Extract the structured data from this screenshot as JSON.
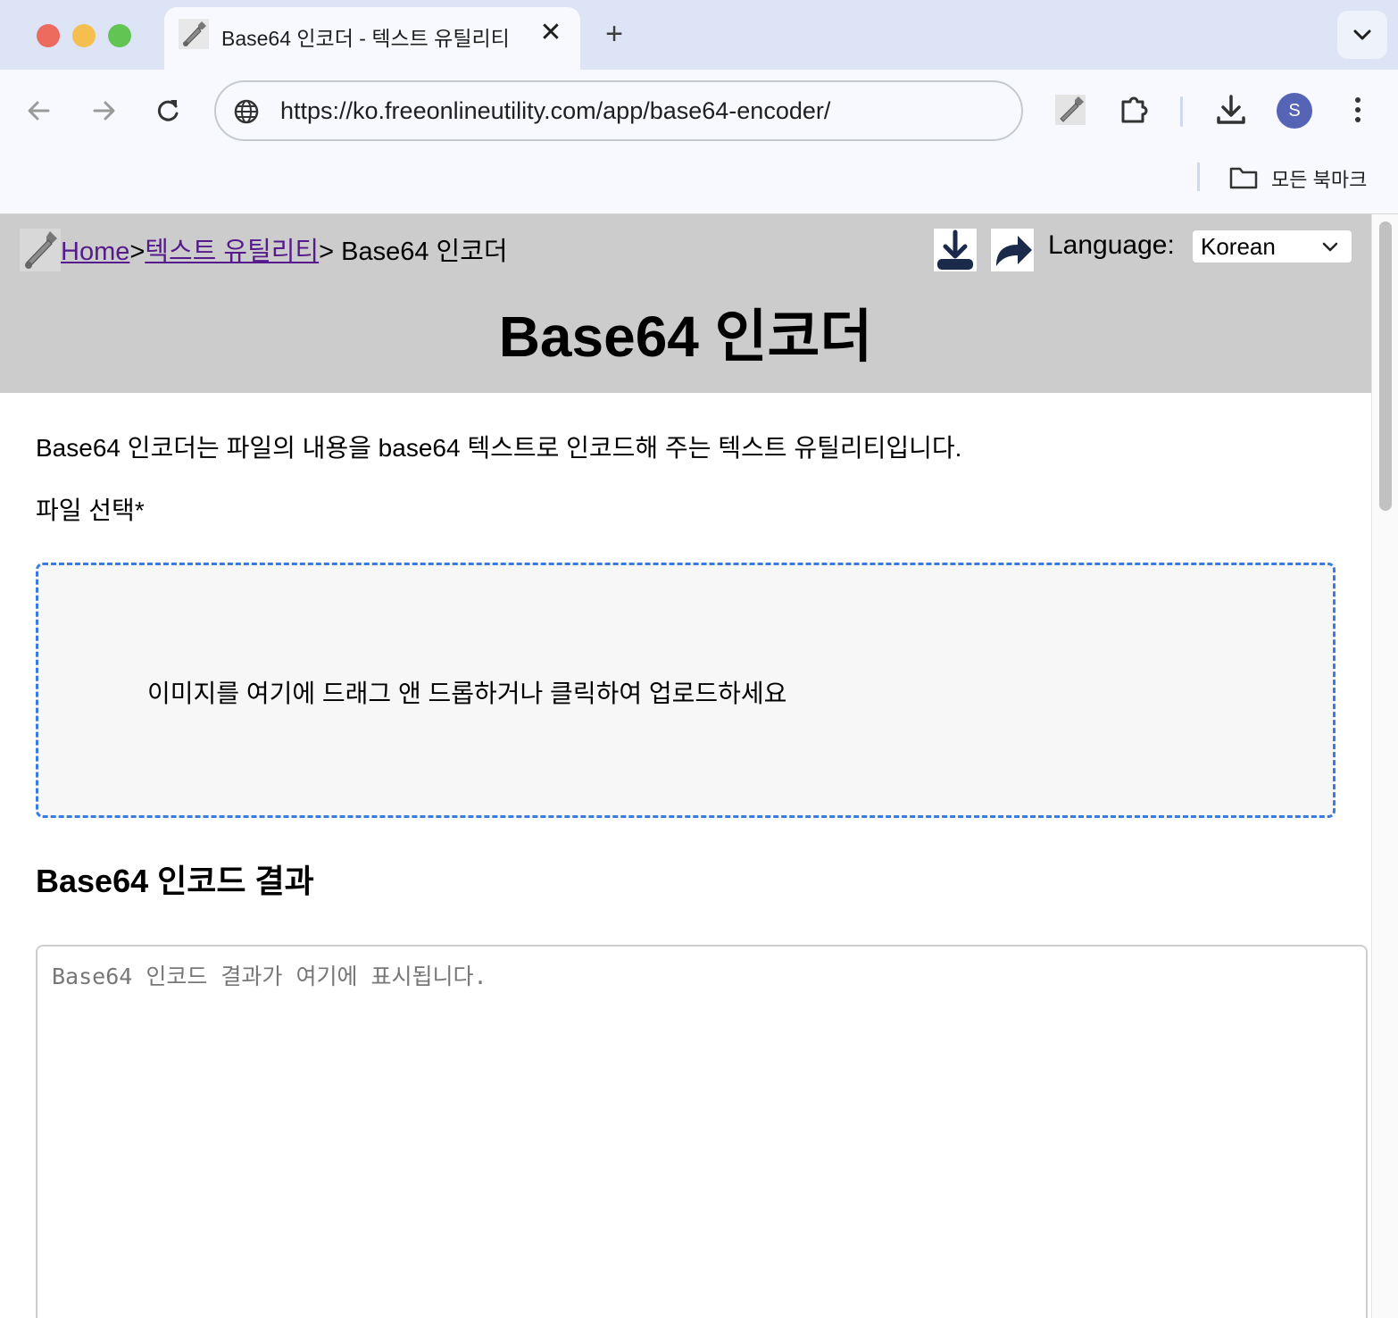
{
  "browser": {
    "tab": {
      "title": "Base64 인코더 - 텍스트 유틸리티",
      "close": "✕"
    },
    "new_tab": "+",
    "url": "https://ko.freeonlineutility.com/app/base64-encoder/",
    "profile_initial": "S",
    "bookmarks_label": "모든 북마크"
  },
  "page": {
    "breadcrumb": {
      "home": "Home",
      "separator1": ">",
      "category": "텍스트 유틸리티",
      "separator2": "> ",
      "current": "Base64 인코더"
    },
    "language_label": "Language:",
    "language_value": "Korean",
    "title": "Base64 인코더",
    "intro": "Base64 인코더는 파일의 내용을 base64 텍스트로 인코드해 주는 텍스트 유틸리티입니다.",
    "file_label": "파일 선택*",
    "dropzone_text": "이미지를 여기에 드래그 앤 드롭하거나 클릭하여 업로드하세요",
    "result_heading": "Base64 인코드 결과",
    "result_placeholder": "Base64 인코드 결과가 여기에 표시됩니다."
  },
  "colors": {
    "tabstrip": "#dce4f5",
    "header_bg": "#cccccc",
    "link": "#551a8b",
    "dropzone_border": "#3a7be0",
    "avatar": "#5664b5"
  }
}
